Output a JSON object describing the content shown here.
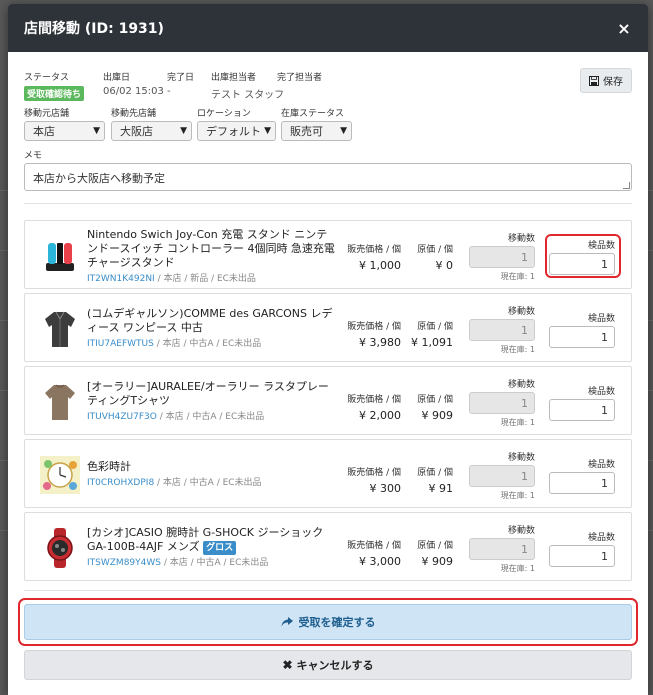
{
  "modal": {
    "title": "店間移動 (ID: 1931)",
    "close_glyph": "×"
  },
  "meta": {
    "status_label": "ステータス",
    "status_value": "受取確認待ち",
    "shipped_label": "出庫日",
    "shipped_value": "06/02 15:03",
    "completed_label": "完了日",
    "completed_value": "-",
    "ship_staff_label": "出庫担当者",
    "ship_staff_value": "テスト スタッフ",
    "done_staff_label": "完了担当者",
    "done_staff_value": "-",
    "save_label": "保存"
  },
  "selects": {
    "from_label": "移動元店舗",
    "from_value": "本店",
    "to_label": "移動先店舗",
    "to_value": "大阪店",
    "location_label": "ロケーション",
    "location_value": "デフォルト",
    "stock_status_label": "在庫ステータス",
    "stock_status_value": "販売可"
  },
  "memo": {
    "label": "メモ",
    "value": "本店から大阪店へ移動予定"
  },
  "columns": {
    "sale_price": "販売価格 / 個",
    "cost": "原価 / 個",
    "move_qty": "移動数",
    "inspect_qty": "検品数",
    "current_stock_prefix": "現在庫:"
  },
  "items": [
    {
      "name": "Nintendo Swich Joy-Con 充電 スタンド ニンテンドースイッチ コントローラー 4個同時 急速充電 チャージスタンド",
      "sku": "IT2WN1K492NI",
      "info": " / 本店 / 新品 / EC未出品",
      "sale_price": "¥ 1,000",
      "cost": "¥ 0",
      "move_qty": "1",
      "current_stock": "1",
      "inspect_qty": "1",
      "icon": "joycon-charger-icon"
    },
    {
      "name": "(コムデギャルソン)COMME des GARCONS レディース ワンピース 中古",
      "sku": "ITIU7AEFWTUS",
      "info": " / 本店 / 中古A / EC未出品",
      "sale_price": "¥ 3,980",
      "cost": "¥ 1,091",
      "move_qty": "1",
      "current_stock": "1",
      "inspect_qty": "1",
      "icon": "dress-icon"
    },
    {
      "name": "[オーラリー]AURALEE/オーラリー ラスタプレーティングTシャツ",
      "sku": "ITUVH4ZU7F3O",
      "info": " / 本店 / 中古A / EC未出品",
      "sale_price": "¥ 2,000",
      "cost": "¥ 909",
      "move_qty": "1",
      "current_stock": "1",
      "inspect_qty": "1",
      "icon": "tshirt-icon"
    },
    {
      "name": "色彩時計",
      "sku": "IT0CROHXDPI8",
      "info": " / 本店 / 中古A / EC未出品",
      "sale_price": "¥ 300",
      "cost": "¥ 91",
      "move_qty": "1",
      "current_stock": "1",
      "inspect_qty": "1",
      "icon": "color-clock-icon"
    },
    {
      "name": "[カシオ]CASIO 腕時計 G-SHOCK ジーショック GA-100B-4AJF メンズ",
      "tag": "グロス",
      "sku": "ITSWZM89Y4WS",
      "info": " / 本店 / 中古A / EC未出品",
      "sale_price": "¥ 3,000",
      "cost": "¥ 909",
      "move_qty": "1",
      "current_stock": "1",
      "inspect_qty": "1",
      "icon": "watch-icon"
    }
  ],
  "actions": {
    "confirm_label": "受取を確定する",
    "cancel_label": "キャンセルする"
  },
  "colors": {
    "header_bg": "#2d3339",
    "status_green": "#5cb85c",
    "link_blue": "#3a8dc9",
    "highlight_red": "#e0272c",
    "confirm_bg": "#cfe4f5"
  }
}
